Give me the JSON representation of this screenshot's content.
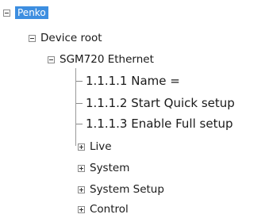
{
  "tree": {
    "root": {
      "label": "Penko"
    },
    "device_root": {
      "label": "Device root"
    },
    "device": {
      "label": "SGM720 Ethernet"
    },
    "leaves": [
      {
        "label": "1.1.1.1 Name ="
      },
      {
        "label": "1.1.1.2 Start Quick setup"
      },
      {
        "label": "1.1.1.3 Enable Full setup"
      }
    ],
    "groups": [
      {
        "label": "Live"
      },
      {
        "label": "System"
      },
      {
        "label": "System Setup"
      },
      {
        "label": "Control"
      }
    ]
  }
}
